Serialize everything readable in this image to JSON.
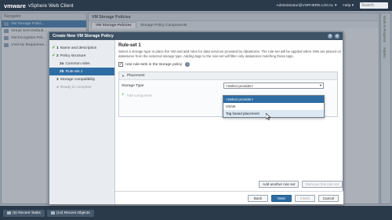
{
  "topbar": {
    "brand": "vmware",
    "product": "vSphere Web Client",
    "user": "Administrator@VSPHERE.LOCAL",
    "help": "Help",
    "search_placeholder": "Search"
  },
  "navigator": {
    "title": "Navigator",
    "items": [
      {
        "label": "VM Storage Polici..."
      },
      {
        "label": "Virtual SAN Default..."
      },
      {
        "label": "VM Encryption Poli..."
      },
      {
        "label": "VVol No Requireme..."
      }
    ]
  },
  "main": {
    "title": "VM Storage Policies",
    "tabs": [
      {
        "label": "VM Storage Policies"
      },
      {
        "label": "Storage Policy Components"
      }
    ]
  },
  "right_rail": {
    "items": [
      {
        "label": "Work In Progress"
      },
      {
        "label": "Alarms"
      }
    ]
  },
  "dialog": {
    "title": "Create New VM Storage Policy",
    "steps": [
      {
        "num": "1",
        "label": "Name and description",
        "done": true
      },
      {
        "num": "2",
        "label": "Policy structure",
        "done": true
      },
      {
        "num": "2a",
        "label": "Common rules",
        "done": true
      },
      {
        "num": "2b",
        "label": "Rule-set 1",
        "done": false,
        "current": true
      },
      {
        "num": "3",
        "label": "Storage compatibility",
        "done": false
      },
      {
        "num": "4",
        "label": "Ready to complete",
        "done": false
      }
    ],
    "content": {
      "title": "Rule-set 1",
      "description": "Select a storage type to place the VM and add rules for data services provided by datastores. The rule-set will be applied when VMs are placed on datastores from the selected storage type. Adding tags to the rule-set will filter only datastores matching those tags.",
      "use_rule_sets_label": "Use rule-sets in the storage policy",
      "placement_label": "Placement",
      "storage_type_label": "Storage Type",
      "storage_type_value": "<Select provider>",
      "add_component_label": "Add component"
    },
    "dropdown_options": [
      {
        "label": "<Select provider>",
        "state": "selected"
      },
      {
        "label": "VSAN",
        "state": "normal"
      },
      {
        "label": "Tag based placement",
        "state": "hover"
      }
    ],
    "ruleset_buttons": {
      "add": "Add another rule set",
      "remove": "Remove this rule set"
    },
    "footer": {
      "back": "Back",
      "next": "Next",
      "finish": "Finish",
      "cancel": "Cancel"
    }
  },
  "bottombar": {
    "tabs": [
      {
        "label": "Recent Tasks",
        "count": "(5)"
      },
      {
        "label": "Recent Objects",
        "count": "(14)"
      }
    ]
  },
  "colors": {
    "accent": "#2e6da4",
    "topbar": "#2b3a4a",
    "check": "#2a9b2a"
  }
}
